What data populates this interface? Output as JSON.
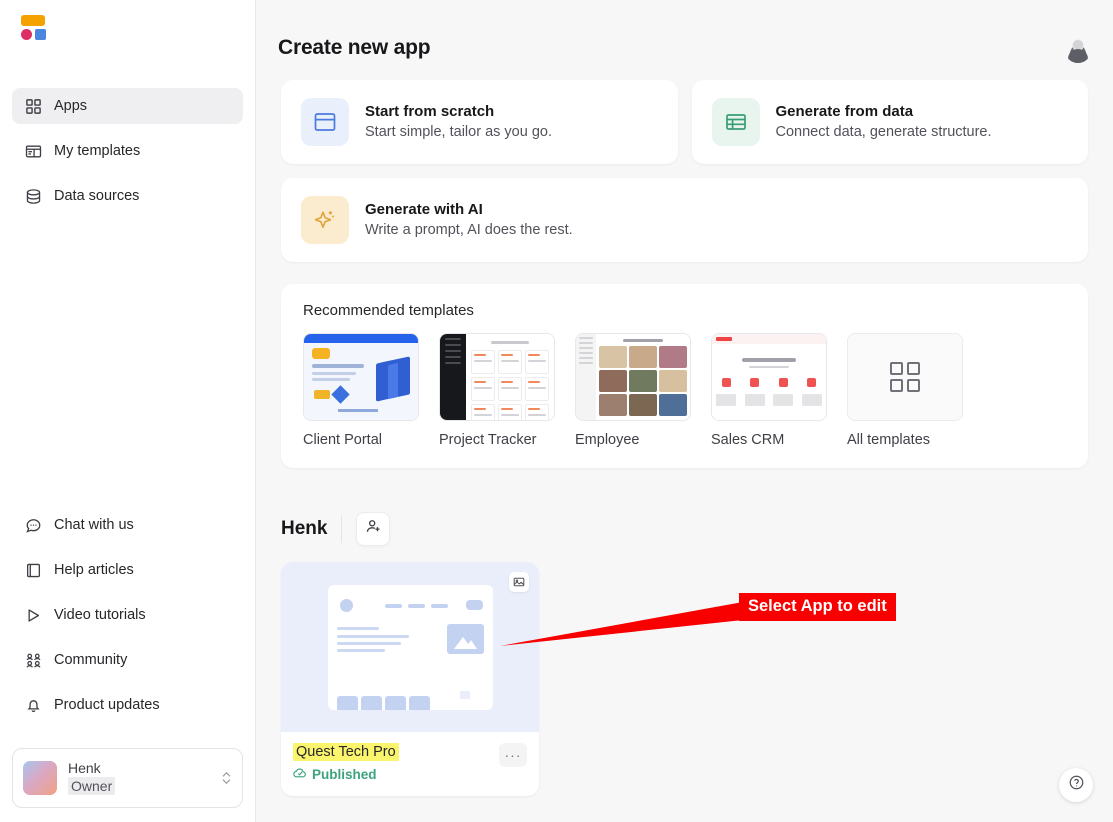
{
  "sidebar": {
    "logo": {
      "name": "app-logo"
    },
    "nav_top": [
      {
        "label": "Apps",
        "icon": "grid-icon",
        "active": true
      },
      {
        "label": "My templates",
        "icon": "template-icon",
        "active": false
      },
      {
        "label": "Data sources",
        "icon": "database-icon",
        "active": false
      }
    ],
    "nav_bottom": [
      {
        "label": "Chat with us",
        "icon": "chat-icon"
      },
      {
        "label": "Help articles",
        "icon": "book-icon"
      },
      {
        "label": "Video tutorials",
        "icon": "play-icon"
      },
      {
        "label": "Community",
        "icon": "people-icon"
      },
      {
        "label": "Product updates",
        "icon": "bell-icon"
      }
    ],
    "user": {
      "name": "Henk",
      "role": "Owner"
    }
  },
  "main": {
    "page_title": "Create new app",
    "create_options": [
      {
        "title": "Start from scratch",
        "subtitle": "Start simple, tailor as you go.",
        "icon": "window-icon",
        "tone": "blue"
      },
      {
        "title": "Generate from data",
        "subtitle": "Connect data, generate structure.",
        "icon": "table-icon",
        "tone": "green"
      },
      {
        "title": "Generate with AI",
        "subtitle": "Write a prompt, AI does the rest.",
        "icon": "sparkle-icon",
        "tone": "amber"
      }
    ],
    "templates": {
      "title": "Recommended templates",
      "items": [
        {
          "label": "Client Portal",
          "art": "client"
        },
        {
          "label": "Project Tracker",
          "art": "project"
        },
        {
          "label": "Employee",
          "art": "employee"
        },
        {
          "label": "Sales CRM",
          "art": "crm"
        },
        {
          "label": "All templates",
          "art": "all"
        }
      ]
    },
    "workspace": {
      "title": "Henk",
      "invite_icon": "add-user-icon",
      "apps": [
        {
          "name": "Quest Tech Pro",
          "status": "Published",
          "status_icon": "cloud-check-icon",
          "more_label": "···"
        }
      ]
    }
  },
  "annotation": {
    "label": "Select App to edit",
    "color": "#f80000"
  },
  "help_fab": {
    "icon": "question-circle-icon"
  },
  "topbar": {
    "avatar": "user-avatar"
  }
}
